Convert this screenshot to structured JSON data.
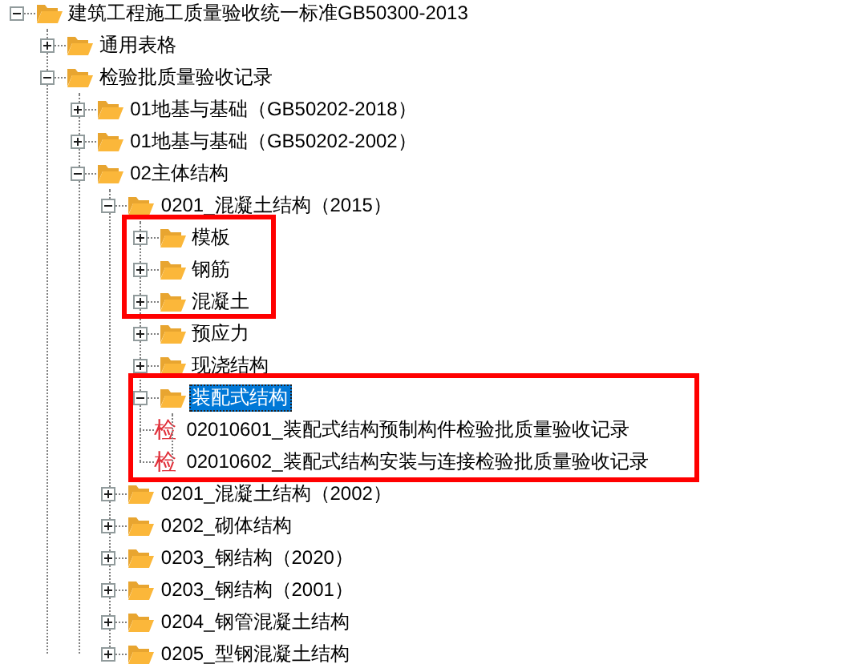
{
  "tree": [
    {
      "kind": "folder",
      "label": "建筑工程施工质量验收统一标准GB50300-2013",
      "expanded": true,
      "selected": false,
      "children": [
        {
          "kind": "folder",
          "label": "通用表格",
          "expanded": false,
          "selected": false
        },
        {
          "kind": "folder",
          "label": "检验批质量验收记录",
          "expanded": true,
          "selected": false,
          "children": [
            {
              "kind": "folder",
              "label": "01地基与基础（GB50202-2018）",
              "expanded": false,
              "selected": false
            },
            {
              "kind": "folder",
              "label": "01地基与基础（GB50202-2002）",
              "expanded": false,
              "selected": false
            },
            {
              "kind": "folder",
              "label": "02主体结构",
              "expanded": true,
              "selected": false,
              "children": [
                {
                  "kind": "folder",
                  "label": "0201_混凝土结构（2015）",
                  "expanded": true,
                  "selected": false,
                  "children": [
                    {
                      "kind": "folder",
                      "label": "模板",
                      "expanded": false,
                      "selected": false
                    },
                    {
                      "kind": "folder",
                      "label": "钢筋",
                      "expanded": false,
                      "selected": false
                    },
                    {
                      "kind": "folder",
                      "label": "混凝土",
                      "expanded": false,
                      "selected": false
                    },
                    {
                      "kind": "folder",
                      "label": "预应力",
                      "expanded": false,
                      "selected": false
                    },
                    {
                      "kind": "folder",
                      "label": "现浇结构",
                      "expanded": false,
                      "selected": false
                    },
                    {
                      "kind": "folder",
                      "label": "装配式结构",
                      "expanded": true,
                      "selected": true,
                      "children": [
                        {
                          "kind": "form",
                          "icon_text": "检",
                          "label": "02010601_装配式结构预制构件检验批质量验收记录",
                          "selected": false
                        },
                        {
                          "kind": "form",
                          "icon_text": "检",
                          "label": "02010602_装配式结构安装与连接检验批质量验收记录",
                          "selected": false
                        }
                      ]
                    }
                  ]
                },
                {
                  "kind": "folder",
                  "label": "0201_混凝土结构（2002）",
                  "expanded": false,
                  "selected": false
                },
                {
                  "kind": "folder",
                  "label": "0202_砌体结构",
                  "expanded": false,
                  "selected": false
                },
                {
                  "kind": "folder",
                  "label": "0203_钢结构（2020）",
                  "expanded": false,
                  "selected": false
                },
                {
                  "kind": "folder",
                  "label": "0203_钢结构（2001）",
                  "expanded": false,
                  "selected": false
                },
                {
                  "kind": "folder",
                  "label": "0204_钢管混凝土结构",
                  "expanded": false,
                  "selected": false
                },
                {
                  "kind": "folder",
                  "label": "0205_型钢混凝土结构",
                  "expanded": false,
                  "selected": false
                }
              ]
            }
          ]
        }
      ]
    }
  ]
}
